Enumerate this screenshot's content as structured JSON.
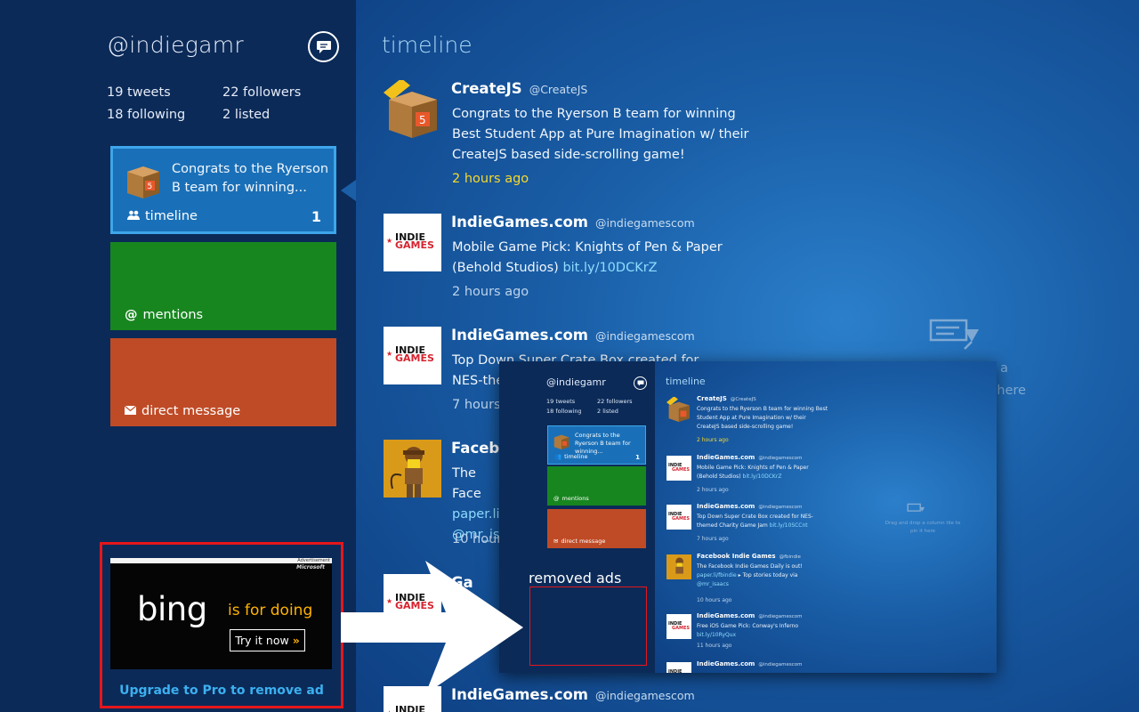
{
  "profile": {
    "handle": "@indiegamr",
    "tweets": "19 tweets",
    "followers": "22 followers",
    "following": "18 following",
    "listed": "2 listed"
  },
  "tiles": {
    "timeline": {
      "preview": "Congrats to the Ryerson B team for winning...",
      "label": "timeline",
      "count": "1"
    },
    "mentions": {
      "label": "mentions"
    },
    "direct": {
      "label": "direct message"
    }
  },
  "ad": {
    "topbar": "Advertisement",
    "sponsor": "Microsoft",
    "brand": "bing",
    "tagline": "is for doing",
    "cta": "Try it now",
    "cta_glyph": "»",
    "upgrade": "Upgrade to Pro to remove ad"
  },
  "timeline": {
    "title": "timeline",
    "tweets": [
      {
        "name": "CreateJS",
        "handle": "@CreateJS",
        "text": "Congrats to the Ryerson B team for winning Best Student App at Pure Imagination w/ their CreateJS based side-scrolling game!",
        "time": "2 hours ago"
      },
      {
        "name": "IndieGames.com",
        "handle": "@indiegamescom",
        "text": "Mobile Game Pick: Knights of Pen & Paper (Behold Studios)",
        "link": "bit.ly/10DCKrZ",
        "time": "2 hours ago"
      },
      {
        "name": "IndieGames.com",
        "handle": "@indiegamescom",
        "text": "Top Down Super Crate Box created for NES-themed",
        "time": "7 hours a"
      },
      {
        "name": "Facebo",
        "handle": "",
        "text": "The Face",
        "link": "paper.li/",
        "mention": "@mr_isa",
        "time": "10 hours"
      },
      {
        "name": "Ga",
        "handle": "",
        "text": "Fre",
        "time": "11"
      },
      {
        "name": "IndieGames.com",
        "handle": "@indiegamescom",
        "text": "",
        "time": ""
      }
    ],
    "pin_hint_partial": [
      "a",
      "t here"
    ]
  },
  "logo_text": {
    "line1": "INDIE",
    "line2": "GAMES"
  },
  "overlay": {
    "removed_label": "removed ads",
    "handle": "@indiegamr",
    "tweets": "19 tweets",
    "followers": "22 followers",
    "following": "18 following",
    "listed": "2 listed",
    "tile_preview": "Congrats to the Ryerson B team for winning...",
    "tile_timeline": "timeline",
    "tile_count": "1",
    "tile_mentions": "mentions",
    "tile_direct": "direct message",
    "title": "timeline",
    "pin_hint": "Drag and drop a column tile to pin it here",
    "tweets_list": [
      {
        "name": "CreateJS",
        "handle": "@CreateJS",
        "text": "Congrats to the Ryerson B team for winning Best Student App at Pure Imagination w/ their CreateJS based side-scrolling game!",
        "time": "2 hours ago"
      },
      {
        "name": "IndieGames.com",
        "handle": "@indiegamescom",
        "text": "Mobile Game Pick: Knights of Pen & Paper (Behold Studios)",
        "link": "bit.ly/10DCKrZ",
        "time": "2 hours ago"
      },
      {
        "name": "IndieGames.com",
        "handle": "@indiegamescom",
        "text": "Top Down Super Crate Box created for NES-themed Charity Game Jam",
        "link": "bit.ly/10SCCnt",
        "time": "7 hours ago"
      },
      {
        "name": "Facebook Indie Games",
        "handle": "@fbindie",
        "text": "The Facebook Indie Games Daily is out!",
        "link": "paper.li/fbindie",
        "text2": "▸ Top stories today via",
        "mention": "@mr_isaacs",
        "time": "10 hours ago"
      },
      {
        "name": "IndieGames.com",
        "handle": "@indiegamescom",
        "text": "Free iOS Game Pick: Conway's Inferno",
        "link": "bit.ly/10RyQux",
        "time": "11 hours ago"
      },
      {
        "name": "IndieGames.com",
        "handle": "@indiegamescom",
        "text": "",
        "time": ""
      }
    ]
  },
  "colors": {
    "sidebar": "#0b2a58",
    "main": "#1a5fa8",
    "tile_timeline": "#1a70b8",
    "tile_mentions": "#17861f",
    "tile_direct": "#bf4b26",
    "highlight_red": "#e5161b",
    "time_recent": "#f7d92b",
    "link": "#8fdcff"
  },
  "icons": [
    "compose-icon",
    "people-icon",
    "at-icon",
    "envelope-icon",
    "pin-column-icon",
    "arrow-icon"
  ]
}
